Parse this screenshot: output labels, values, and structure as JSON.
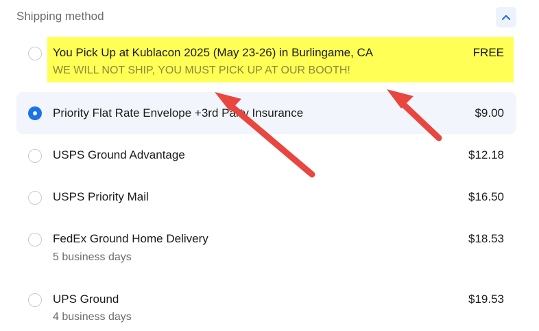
{
  "section": {
    "title": "Shipping method",
    "collapse_icon": "chevron-up-icon"
  },
  "options": [
    {
      "label": "You Pick Up at Kublacon 2025 (May 23-26) in Burlingame, CA",
      "sub": "WE WILL NOT SHIP, YOU MUST PICK UP AT OUR BOOTH!",
      "price": "FREE",
      "selected": false,
      "highlight_color": "#ffff55"
    },
    {
      "label": "Priority Flat Rate Envelope +3rd Party Insurance",
      "sub": "",
      "price": "$9.00",
      "selected": true
    },
    {
      "label": "USPS Ground Advantage",
      "sub": "",
      "price": "$12.18",
      "selected": false
    },
    {
      "label": "USPS Priority Mail",
      "sub": "",
      "price": "$16.50",
      "selected": false
    },
    {
      "label": "FedEx Ground Home Delivery",
      "sub": "5 business days",
      "price": "$18.53",
      "selected": false
    },
    {
      "label": "UPS Ground",
      "sub": "4 business days",
      "price": "$19.53",
      "selected": false
    }
  ],
  "colors": {
    "accent": "#1a73e8",
    "selected_bg": "#f2f5fb",
    "annotation_arrow": "#e8463f"
  }
}
